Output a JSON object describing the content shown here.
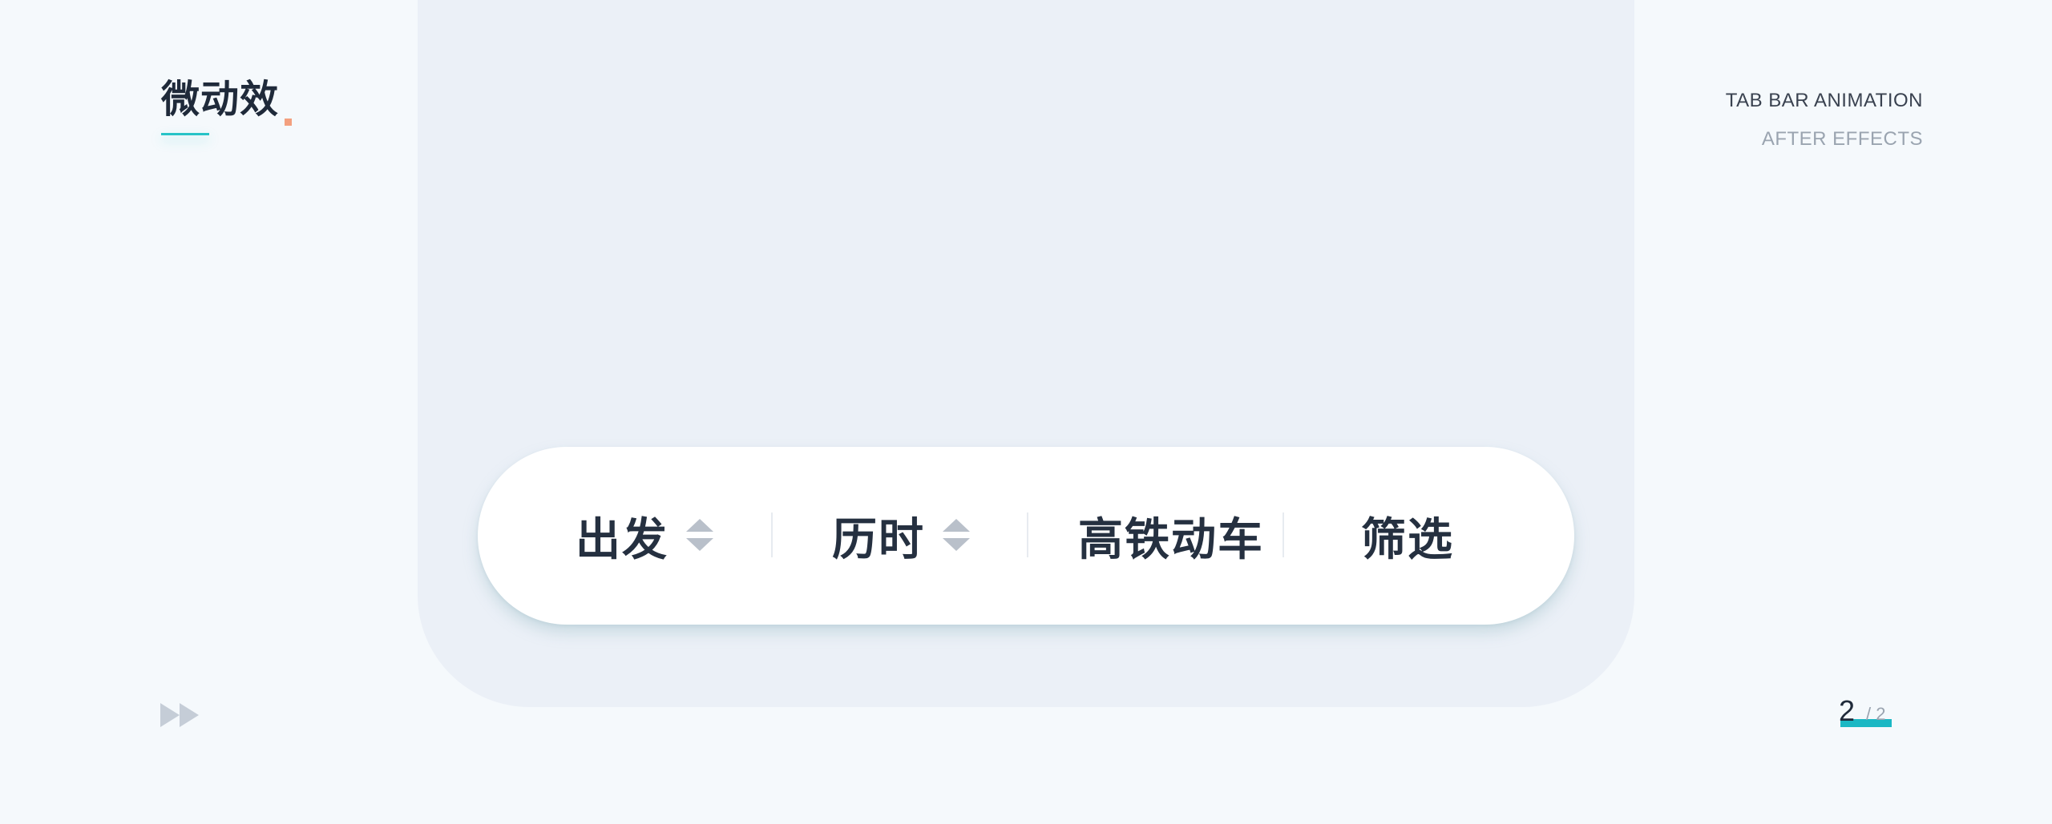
{
  "brand": {
    "title": "微动效",
    "accent_color": "#27c3c7",
    "dot_color": "#f3a07f"
  },
  "meta": {
    "line1": "TAB BAR ANIMATION",
    "line2": "AFTER EFFECTS"
  },
  "tabbar": {
    "tabs": [
      {
        "label": "出发",
        "icon": "sort-icon"
      },
      {
        "label": "历时",
        "icon": "sort-icon"
      },
      {
        "label": "高铁动车"
      },
      {
        "label": "筛选"
      }
    ]
  },
  "footer": {
    "forward_icon": "fast-forward-icon",
    "pager": {
      "current": "2",
      "separator": "/ 2"
    }
  },
  "colors": {
    "background": "#f5f9fc",
    "panel": "#ebf0f7",
    "tabbar": "#ffffff",
    "text_dark": "#253040",
    "icon_gray": "#b9c0ca",
    "pager_accent": "#1bb8c4"
  }
}
